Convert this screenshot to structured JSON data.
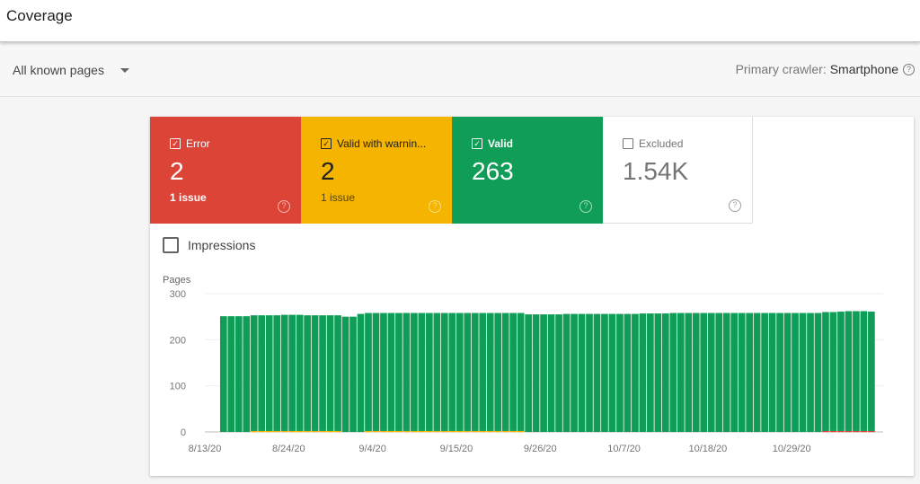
{
  "header": {
    "title": "Coverage"
  },
  "filter": {
    "selected_option": "All known pages",
    "crawler_label": "Primary crawler:",
    "crawler_value": "Smartphone",
    "help_icon": "?"
  },
  "tiles": [
    {
      "label": "Error",
      "checked": true,
      "value": "2",
      "sub": "1 issue",
      "bg": "#dc4437",
      "fg": "#ffffff",
      "sub_fg": "#ffffff",
      "help_fg": "#f5b8b1"
    },
    {
      "label": "Valid with warnin...",
      "checked": true,
      "value": "2",
      "sub": "1 issue",
      "bg": "#f4b400",
      "fg": "#212121",
      "sub_fg": "#5a4300",
      "help_fg": "#fadd80"
    },
    {
      "label": "Valid",
      "checked": true,
      "value": "263",
      "sub": "",
      "bg": "#0f9d58",
      "fg": "#ffffff",
      "sub_fg": "#ffffff",
      "help_fg": "#a8dcbf"
    },
    {
      "label": "Excluded",
      "checked": false,
      "value": "1.54K",
      "sub": "",
      "bg": "#ffffff",
      "fg": "#757575",
      "sub_fg": "#757575",
      "help_fg": "#9e9e9e"
    }
  ],
  "impressions": {
    "label": "Impressions",
    "checked": false
  },
  "chart_data": {
    "type": "bar",
    "stacked": true,
    "ylabel": "Pages",
    "xlabel": "",
    "ylim": [
      0,
      300
    ],
    "yticks": [
      0,
      100,
      200,
      300
    ],
    "grid": true,
    "xtick_labels": [
      "8/13/20",
      "8/24/20",
      "9/4/20",
      "9/15/20",
      "9/26/20",
      "10/7/20",
      "10/18/20",
      "10/29/20"
    ],
    "start_date": "8/13/20",
    "num_days": 87,
    "series": [
      {
        "name": "Valid",
        "color": "#0f9d58",
        "values": [
          0,
          251,
          251,
          251,
          251,
          251,
          251,
          251,
          251,
          252,
          252,
          252,
          251,
          251,
          251,
          251,
          251,
          250,
          250,
          256,
          256,
          256,
          256,
          256,
          256,
          256,
          256,
          256,
          256,
          256,
          256,
          256,
          256,
          256,
          256,
          256,
          256,
          256,
          256,
          256,
          256,
          255,
          255,
          255,
          255,
          255,
          256,
          256,
          256,
          256,
          256,
          256,
          256,
          256,
          256,
          256,
          257,
          257,
          257,
          257,
          258,
          258,
          258,
          258,
          258,
          258,
          258,
          258,
          258,
          258,
          258,
          258,
          258,
          258,
          258,
          258,
          258,
          258,
          258,
          258,
          258,
          258,
          259,
          260,
          260,
          260,
          259
        ]
      },
      {
        "name": "Valid with warnings",
        "color": "#f4b400",
        "values": [
          0,
          0,
          0,
          0,
          0,
          2,
          2,
          2,
          2,
          2,
          2,
          2,
          2,
          2,
          2,
          2,
          2,
          0,
          0,
          0,
          2,
          2,
          2,
          2,
          2,
          2,
          2,
          2,
          2,
          2,
          2,
          2,
          2,
          2,
          2,
          2,
          2,
          2,
          2,
          2,
          2,
          0,
          0,
          0,
          0,
          0,
          0,
          0,
          0,
          0,
          0,
          0,
          0,
          0,
          0,
          0,
          0,
          0,
          0,
          0,
          0,
          0,
          0,
          0,
          0,
          0,
          0,
          0,
          0,
          0,
          0,
          0,
          0,
          0,
          0,
          0,
          0,
          0,
          0,
          0,
          0,
          0,
          0,
          0,
          0,
          0,
          0
        ]
      },
      {
        "name": "Error",
        "color": "#dc4437",
        "values": [
          0,
          0,
          0,
          0,
          0,
          0,
          0,
          0,
          0,
          0,
          0,
          0,
          0,
          0,
          0,
          0,
          0,
          0,
          0,
          0,
          0,
          0,
          0,
          0,
          0,
          0,
          0,
          0,
          0,
          0,
          0,
          0,
          0,
          0,
          0,
          0,
          0,
          0,
          0,
          0,
          0,
          0,
          0,
          0,
          0,
          0,
          0,
          0,
          0,
          0,
          0,
          0,
          0,
          0,
          0,
          0,
          0,
          0,
          0,
          0,
          0,
          0,
          0,
          0,
          0,
          0,
          0,
          0,
          0,
          0,
          0,
          0,
          0,
          0,
          0,
          0,
          0,
          0,
          0,
          0,
          2,
          2,
          2,
          2,
          2,
          2,
          2
        ]
      }
    ]
  }
}
